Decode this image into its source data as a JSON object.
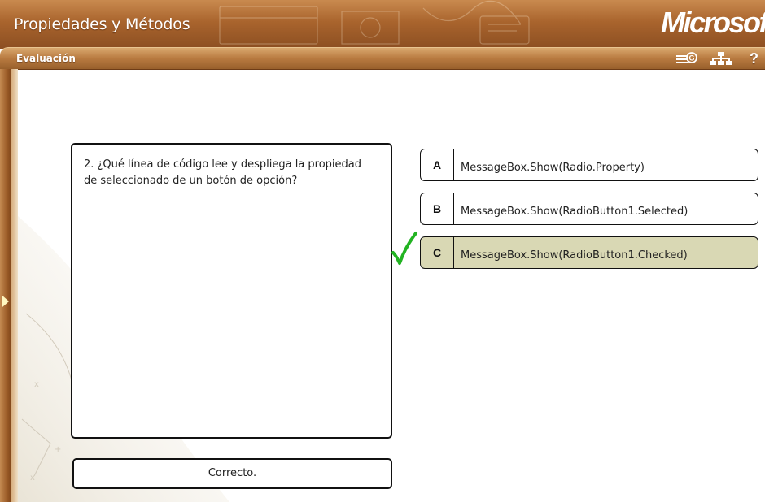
{
  "header": {
    "title": "Propiedades y Métodos",
    "brand": "Microsoft"
  },
  "toolbar": {
    "section_title": "Evaluación",
    "icons": [
      "glossary-icon",
      "sitemap-icon",
      "help-icon"
    ],
    "help_label": "?"
  },
  "question": {
    "text": "2. ¿Qué línea de código lee y despliega la propiedad de seleccionado de un botón de opción?"
  },
  "options": [
    {
      "letter": "A",
      "text": "MessageBox.Show(Radio.Property)",
      "selected": false
    },
    {
      "letter": "B",
      "text": "MessageBox.Show(RadioButton1.Selected)",
      "selected": false
    },
    {
      "letter": "C",
      "text": "MessageBox.Show(RadioButton1.Checked)",
      "selected": true
    }
  ],
  "feedback": {
    "text": "Correcto."
  },
  "colors": {
    "frame_brown": "#a9642d",
    "selected_option": "#d9d8b4",
    "check_green": "#22b322"
  }
}
